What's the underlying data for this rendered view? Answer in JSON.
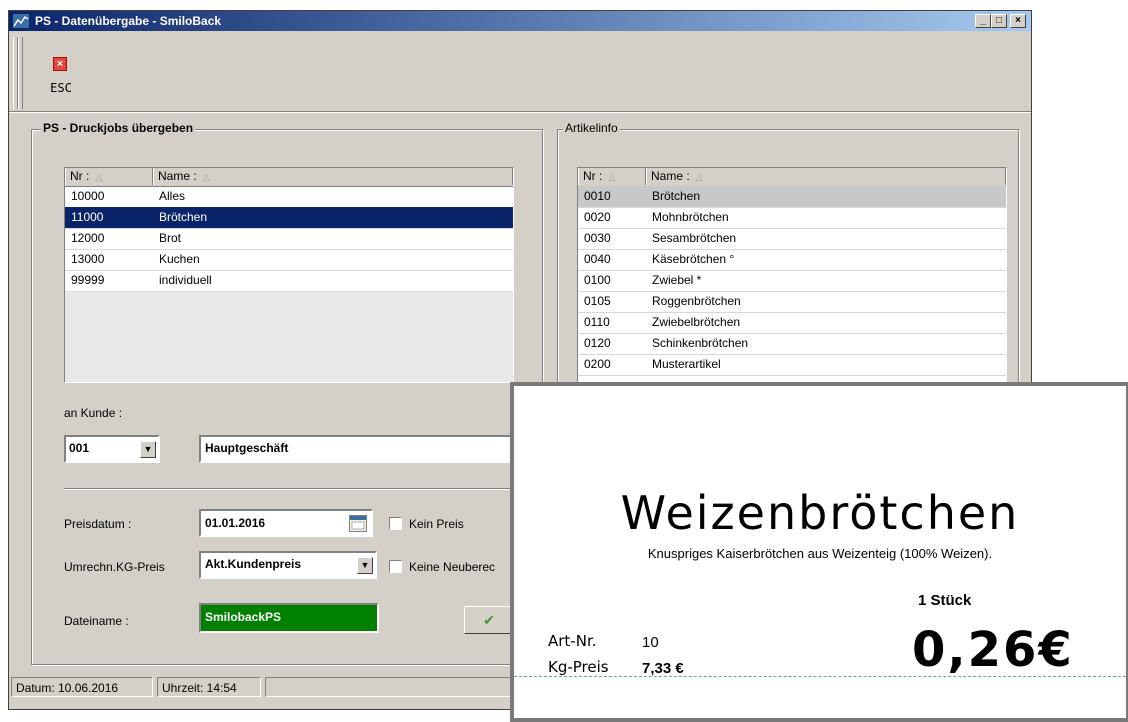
{
  "window": {
    "title": "PS - Datenübergabe - SmiloBack",
    "btn_min": "_",
    "btn_max": "□",
    "btn_close": "×"
  },
  "toolbar": {
    "esc_label": "ESC",
    "esc_icon_glyph": "×"
  },
  "druckjobs": {
    "group_title": "PS - Druckjobs übergeben",
    "columns": [
      "Nr :",
      "Name :"
    ],
    "sort_glyph": "△",
    "rows": [
      {
        "nr": "10000",
        "name": "Alles"
      },
      {
        "nr": "11000",
        "name": "Brötchen"
      },
      {
        "nr": "12000",
        "name": "Brot"
      },
      {
        "nr": "13000",
        "name": "Kuchen"
      },
      {
        "nr": "99999",
        "name": "individuell"
      }
    ],
    "selected_index": 1
  },
  "form": {
    "kunde_label": "an Kunde :",
    "kunde_code": "001",
    "kunde_name": "Hauptgeschäft",
    "preisdatum_label": "Preisdatum :",
    "preisdatum_value": "01.01.2016",
    "kein_preis_label": "Kein Preis",
    "umrechn_label": "Umrechn.KG-Preis",
    "umrechn_value": "Akt.Kundenpreis",
    "keine_neuber_label": "Keine Neuberec",
    "dateiname_label": "Dateiname :",
    "dateiname_value": "SmilobackPS",
    "ok_glyph": "✔",
    "dropdown_glyph": "▼"
  },
  "artikelinfo": {
    "group_title": "Artikelinfo",
    "columns": [
      "Nr :",
      "Name :"
    ],
    "sort_glyph": "△",
    "rows": [
      {
        "nr": "0010",
        "name": "Brötchen"
      },
      {
        "nr": "0020",
        "name": "Mohnbrötchen"
      },
      {
        "nr": "0030",
        "name": "Sesambrötchen"
      },
      {
        "nr": "0040",
        "name": "Käsebrötchen °"
      },
      {
        "nr": "0100",
        "name": "Zwiebel  *"
      },
      {
        "nr": "0105",
        "name": "Roggenbrötchen"
      },
      {
        "nr": "0110",
        "name": "Zwiebelbrötchen"
      },
      {
        "nr": "0120",
        "name": "Schinkenbrötchen"
      },
      {
        "nr": "0200",
        "name": "Musterartikel"
      }
    ],
    "selected_index": 0
  },
  "status": {
    "datum": "Datum: 10.06.2016",
    "uhrzeit": "Uhrzeit: 14:54"
  },
  "label_preview": {
    "title": "Weizenbrötchen",
    "description": "Knuspriges Kaiserbrötchen aus Weizenteig (100% Weizen).",
    "unit": "1 Stück",
    "art_label": "Art-Nr.",
    "art_value": "10",
    "kg_label": "Kg-Preis",
    "kg_value": "7,33 €",
    "price": "0,26€"
  },
  "colors": {
    "selection": "#0a246a",
    "dateiname_bg": "#008000",
    "window_bg": "#d4d0c8"
  }
}
